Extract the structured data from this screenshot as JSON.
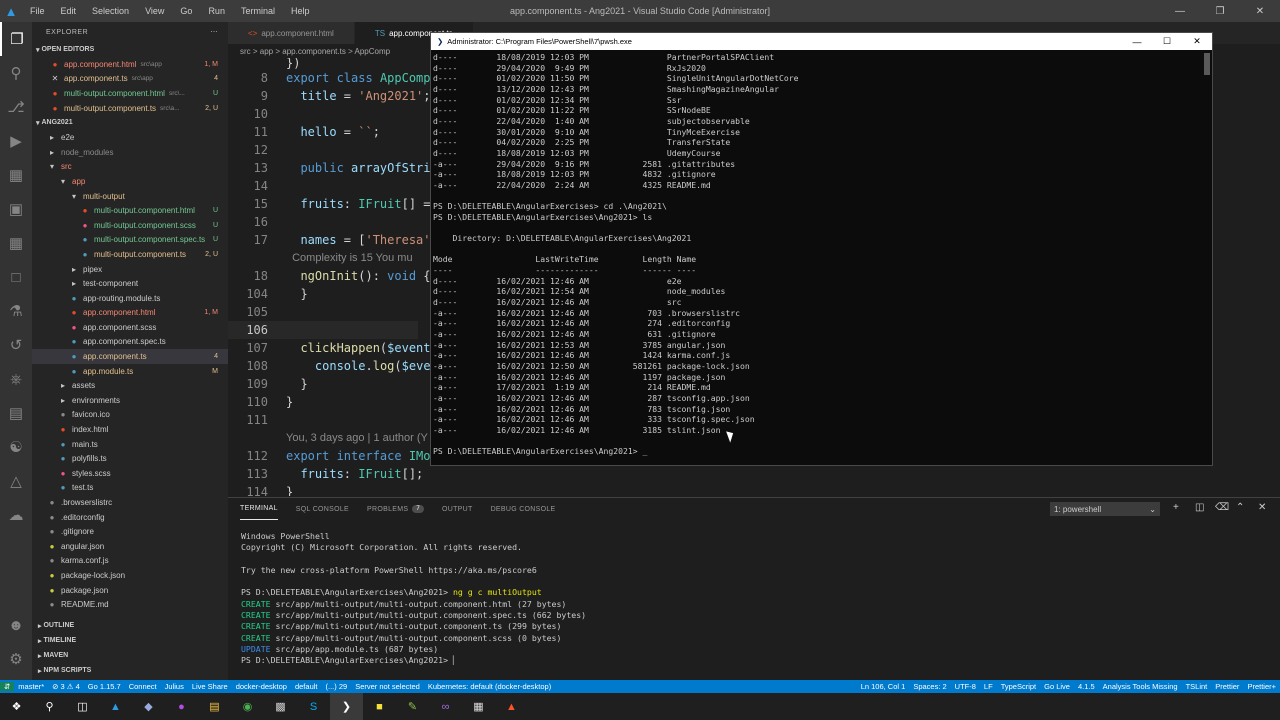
{
  "window_title": "app.component.ts - Ang2021 - Visual Studio Code [Administrator]",
  "menu": [
    "File",
    "Edit",
    "Selection",
    "View",
    "Go",
    "Run",
    "Terminal",
    "Help"
  ],
  "explorer": {
    "title": "EXPLORER",
    "open_editors_label": "OPEN EDITORS",
    "open_editors": [
      {
        "name": "app.component.html",
        "desc": "src\\app",
        "badge": "1, M",
        "cls": "c-err",
        "close": false
      },
      {
        "name": "app.component.ts",
        "desc": "src\\app",
        "badge": "4",
        "cls": "c-mod",
        "close": true
      },
      {
        "name": "multi-output.component.html",
        "desc": "src\\...",
        "badge": "U",
        "cls": "c-new",
        "close": false
      },
      {
        "name": "multi-output.component.ts",
        "desc": "src\\a...",
        "badge": "2, U",
        "cls": "c-mod",
        "close": false
      }
    ],
    "project_label": "ANG2021",
    "tree": [
      {
        "name": "e2e",
        "indent": 1,
        "type": "folder",
        "cls": ""
      },
      {
        "name": "node_modules",
        "indent": 1,
        "type": "folder",
        "cls": "c-dim"
      },
      {
        "name": "src",
        "indent": 1,
        "type": "folder-open",
        "cls": "c-err"
      },
      {
        "name": "app",
        "indent": 2,
        "type": "folder-open",
        "cls": "c-err"
      },
      {
        "name": "multi-output",
        "indent": 3,
        "type": "folder-open",
        "cls": "c-mod"
      },
      {
        "name": "multi-output.component.html",
        "indent": 4,
        "type": "file",
        "cls": "c-new",
        "badge": "U"
      },
      {
        "name": "multi-output.component.scss",
        "indent": 4,
        "type": "file",
        "cls": "c-new",
        "badge": "U"
      },
      {
        "name": "multi-output.component.spec.ts",
        "indent": 4,
        "type": "file",
        "cls": "c-new",
        "badge": "U"
      },
      {
        "name": "multi-output.component.ts",
        "indent": 4,
        "type": "file",
        "cls": "c-mod",
        "badge": "2, U"
      },
      {
        "name": "pipex",
        "indent": 3,
        "type": "folder",
        "cls": ""
      },
      {
        "name": "test-component",
        "indent": 3,
        "type": "folder",
        "cls": ""
      },
      {
        "name": "app-routing.module.ts",
        "indent": 3,
        "type": "file",
        "cls": ""
      },
      {
        "name": "app.component.html",
        "indent": 3,
        "type": "file",
        "cls": "c-err",
        "badge": "1, M"
      },
      {
        "name": "app.component.scss",
        "indent": 3,
        "type": "file",
        "cls": ""
      },
      {
        "name": "app.component.spec.ts",
        "indent": 3,
        "type": "file",
        "cls": ""
      },
      {
        "name": "app.component.ts",
        "indent": 3,
        "type": "file",
        "cls": "c-mod",
        "badge": "4",
        "sel": true
      },
      {
        "name": "app.module.ts",
        "indent": 3,
        "type": "file",
        "cls": "c-mod",
        "badge": "M"
      },
      {
        "name": "assets",
        "indent": 2,
        "type": "folder",
        "cls": ""
      },
      {
        "name": "environments",
        "indent": 2,
        "type": "folder",
        "cls": ""
      },
      {
        "name": "favicon.ico",
        "indent": 2,
        "type": "file",
        "cls": ""
      },
      {
        "name": "index.html",
        "indent": 2,
        "type": "file",
        "cls": ""
      },
      {
        "name": "main.ts",
        "indent": 2,
        "type": "file",
        "cls": ""
      },
      {
        "name": "polyfills.ts",
        "indent": 2,
        "type": "file",
        "cls": ""
      },
      {
        "name": "styles.scss",
        "indent": 2,
        "type": "file",
        "cls": ""
      },
      {
        "name": "test.ts",
        "indent": 2,
        "type": "file",
        "cls": ""
      },
      {
        "name": ".browserslistrc",
        "indent": 1,
        "type": "file",
        "cls": ""
      },
      {
        "name": ".editorconfig",
        "indent": 1,
        "type": "file",
        "cls": ""
      },
      {
        "name": ".gitignore",
        "indent": 1,
        "type": "file",
        "cls": ""
      },
      {
        "name": "angular.json",
        "indent": 1,
        "type": "file",
        "cls": ""
      },
      {
        "name": "karma.conf.js",
        "indent": 1,
        "type": "file",
        "cls": ""
      },
      {
        "name": "package-lock.json",
        "indent": 1,
        "type": "file",
        "cls": ""
      },
      {
        "name": "package.json",
        "indent": 1,
        "type": "file",
        "cls": ""
      },
      {
        "name": "README.md",
        "indent": 1,
        "type": "file",
        "cls": ""
      }
    ],
    "bottom_sections": [
      "OUTLINE",
      "TIMELINE",
      "MAVEN",
      "NPM SCRIPTS"
    ]
  },
  "tabs": [
    "app.component.html",
    "app.component.ts"
  ],
  "breadcrumb": "src > app > app.component.ts > AppComp",
  "editor_lines": [
    {
      "ln": "8",
      "segs": [
        [
          "kw",
          "export "
        ],
        [
          "kw",
          "class "
        ],
        [
          "cls",
          "AppComp"
        ]
      ]
    },
    {
      "ln": "9",
      "segs": [
        [
          "prop",
          "  title "
        ],
        [
          "plain",
          "= "
        ],
        [
          "str",
          "'Ang2021'"
        ],
        [
          "plain",
          ";"
        ]
      ]
    },
    {
      "ln": "10",
      "segs": []
    },
    {
      "ln": "11",
      "segs": [
        [
          "prop",
          "  hello "
        ],
        [
          "plain",
          "= "
        ],
        [
          "str",
          "``"
        ],
        [
          "plain",
          ";"
        ]
      ]
    },
    {
      "ln": "12",
      "segs": []
    },
    {
      "ln": "13",
      "segs": [
        [
          "kw",
          "  public "
        ],
        [
          "prop",
          "arrayOfStri"
        ]
      ]
    },
    {
      "ln": "14",
      "segs": []
    },
    {
      "ln": "15",
      "segs": [
        [
          "prop",
          "  fruits"
        ],
        [
          "plain",
          ": "
        ],
        [
          "cls",
          "IFruit"
        ],
        [
          "plain",
          "[] ="
        ]
      ]
    },
    {
      "ln": "16",
      "segs": []
    },
    {
      "ln": "17",
      "segs": [
        [
          "prop",
          "  names "
        ],
        [
          "plain",
          "= ["
        ],
        [
          "str",
          "'Theresa'"
        ]
      ]
    },
    {
      "ln": "",
      "segs": [
        [
          "lens",
          "  Complexity is 15 You mu"
        ]
      ]
    },
    {
      "ln": "18",
      "segs": [
        [
          "fn",
          "  ngOnInit"
        ],
        [
          "plain",
          "(): "
        ],
        [
          "kw",
          "void "
        ],
        [
          "plain",
          "{"
        ]
      ]
    },
    {
      "ln": "104",
      "segs": [
        [
          "plain",
          "  }"
        ]
      ]
    },
    {
      "ln": "105",
      "segs": []
    },
    {
      "ln": "106",
      "segs": [],
      "cur": true
    },
    {
      "ln": "107",
      "segs": [
        [
          "fn",
          "  clickHappen"
        ],
        [
          "plain",
          "("
        ],
        [
          "prop",
          "$event"
        ]
      ]
    },
    {
      "ln": "108",
      "segs": [
        [
          "prop",
          "    console"
        ],
        [
          "plain",
          "."
        ],
        [
          "fn",
          "log"
        ],
        [
          "plain",
          "("
        ],
        [
          "prop",
          "$eve"
        ]
      ]
    },
    {
      "ln": "109",
      "segs": [
        [
          "plain",
          "  }"
        ]
      ]
    },
    {
      "ln": "110",
      "segs": [
        [
          "plain",
          "}"
        ]
      ]
    },
    {
      "ln": "111",
      "segs": []
    },
    {
      "ln": "",
      "segs": [
        [
          "lens",
          "You, 3 days ago | 1 author (Y"
        ]
      ]
    },
    {
      "ln": "112",
      "segs": [
        [
          "kw",
          "export "
        ],
        [
          "kw",
          "interface "
        ],
        [
          "cls",
          "IMo"
        ]
      ]
    },
    {
      "ln": "113",
      "segs": [
        [
          "prop",
          "  fruits"
        ],
        [
          "plain",
          ": "
        ],
        [
          "cls",
          "IFruit"
        ],
        [
          "plain",
          "[];"
        ]
      ]
    },
    {
      "ln": "114",
      "segs": [
        [
          "plain",
          "}"
        ]
      ]
    }
  ],
  "editor_top_line": "})",
  "panel": {
    "tabs": [
      "TERMINAL",
      "SQL CONSOLE",
      "PROBLEMS",
      "OUTPUT",
      "DEBUG CONSOLE"
    ],
    "problems_count": "7",
    "terminal_select": "1: powershell",
    "terminal_lines": [
      [
        "",
        "Windows PowerShell"
      ],
      [
        "",
        "Copyright (C) Microsoft Corporation. All rights reserved."
      ],
      [
        "",
        ""
      ],
      [
        "",
        "Try the new cross-platform PowerShell https://aka.ms/pscore6"
      ],
      [
        "",
        ""
      ],
      [
        "prompt",
        "PS D:\\DELETEABLE\\AngularExercises\\Ang2021> ",
        "ng g c multiOutput"
      ],
      [
        "create",
        "CREATE",
        " src/app/multi-output/multi-output.component.html (27 bytes)"
      ],
      [
        "create",
        "CREATE",
        " src/app/multi-output/multi-output.component.spec.ts (662 bytes)"
      ],
      [
        "create",
        "CREATE",
        " src/app/multi-output/multi-output.component.ts (299 bytes)"
      ],
      [
        "create",
        "CREATE",
        " src/app/multi-output/multi-output.component.scss (0 bytes)"
      ],
      [
        "update",
        "UPDATE",
        " src/app/app.module.ts (687 bytes)"
      ],
      [
        "",
        "PS D:\\DELETEABLE\\AngularExercises\\Ang2021> ▏"
      ]
    ]
  },
  "powershell": {
    "title": "Administrator: C:\\Program Files\\PowerShell\\7\\pwsh.exe",
    "lines": [
      "d----        18/08/2019 12:03 PM                PartnerPortalSPAClient",
      "d----        29/04/2020  9:49 PM                RxJs2020",
      "d----        01/02/2020 11:50 PM                SingleUnitAngularDotNetCore",
      "d----        13/12/2020 12:43 PM                SmashingMagazineAngular",
      "d----        01/02/2020 12:34 PM                Ssr",
      "d----        01/02/2020 11:22 PM                SSrNodeBE",
      "d----        22/04/2020  1:40 AM                subjectobservable",
      "d----        30/01/2020  9:10 AM                TinyMceExercise",
      "d----        04/02/2020  2:25 PM                TransferState",
      "d----        18/08/2019 12:03 PM                UdemyCourse",
      "-a---        29/04/2020  9:16 PM           2581 .gitattributes",
      "-a---        18/08/2019 12:03 PM           4832 .gitignore",
      "-a---        22/04/2020  2:24 AM           4325 README.md",
      "",
      "PS D:\\DELETEABLE\\AngularExercises> cd .\\Ang2021\\",
      "PS D:\\DELETEABLE\\AngularExercises\\Ang2021> ls",
      "",
      "    Directory: D:\\DELETEABLE\\AngularExercises\\Ang2021",
      "",
      "Mode                 LastWriteTime         Length Name",
      "----                 -------------         ------ ----",
      "d----        16/02/2021 12:46 AM                e2e",
      "d----        16/02/2021 12:54 AM                node_modules",
      "d----        16/02/2021 12:46 AM                src",
      "-a---        16/02/2021 12:46 AM            703 .browserslistrc",
      "-a---        16/02/2021 12:46 AM            274 .editorconfig",
      "-a---        16/02/2021 12:46 AM            631 .gitignore",
      "-a---        16/02/2021 12:53 AM           3785 angular.json",
      "-a---        16/02/2021 12:46 AM           1424 karma.conf.js",
      "-a---        16/02/2021 12:50 AM         581261 package-lock.json",
      "-a---        16/02/2021 12:46 AM           1197 package.json",
      "-a---        17/02/2021  1:19 AM            214 README.md",
      "-a---        16/02/2021 12:46 AM            287 tsconfig.app.json",
      "-a---        16/02/2021 12:46 AM            783 tsconfig.json",
      "-a---        16/02/2021 12:46 AM            333 tsconfig.spec.json",
      "-a---        16/02/2021 12:46 AM           3185 tslint.json",
      "",
      "PS D:\\DELETEABLE\\AngularExercises\\Ang2021> _"
    ]
  },
  "statusbar": {
    "left": [
      "master*",
      "⊘ 3 ⚠ 4",
      "Go 1.15.7",
      "Connect",
      "Julius",
      "Live Share",
      "docker-desktop",
      "default",
      "(...) 29",
      "Server not selected",
      "Kubernetes: default (docker-desktop)"
    ],
    "right": [
      "Ln 106, Col 1",
      "Spaces: 2",
      "UTF-8",
      "LF",
      "TypeScript",
      "Go Live",
      "4.1.5",
      "Analysis Tools Missing",
      "TSLint",
      "Prettier",
      "Prettier+"
    ]
  },
  "colors": {
    "accent": "#007acc",
    "terminal_bg": "#0c0c0c",
    "editor_bg": "#1e1e1e"
  }
}
